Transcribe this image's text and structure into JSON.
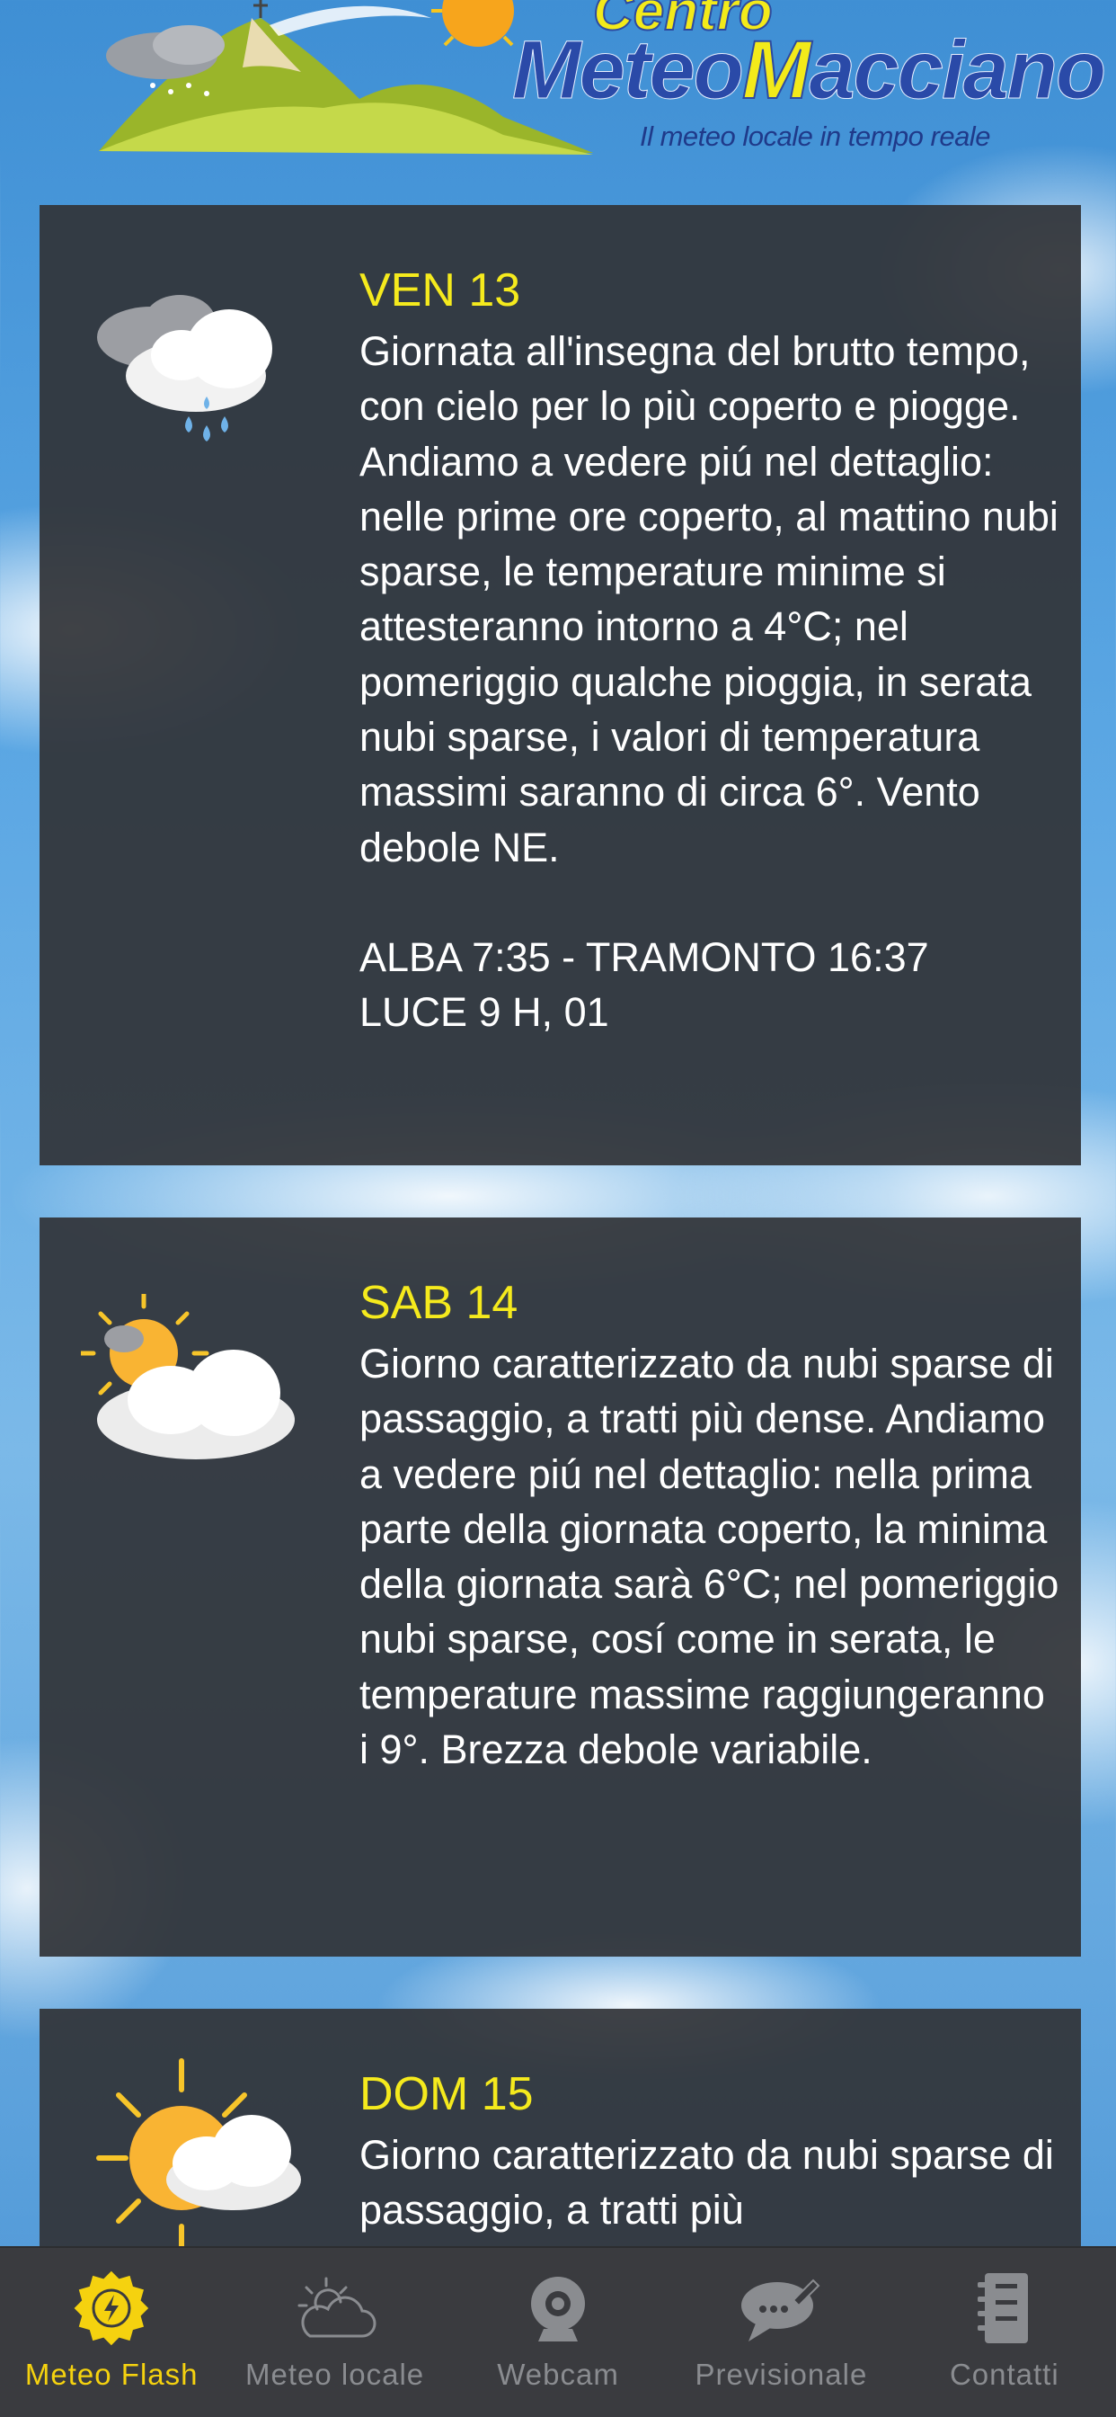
{
  "header": {
    "logo_centro": "Centro",
    "logo_meteo": "Meteo",
    "logo_macciano_initial": "M",
    "logo_macciano_rest": "acciano",
    "logo_subtitle": "Il meteo locale in tempo reale"
  },
  "forecast": [
    {
      "day": "VEN 13",
      "icon": "rain-cloud-icon",
      "description": "Giornata all'insegna del brutto tempo, con cielo per lo più coperto e piogge. Andiamo a vedere piú nel dettaglio: nelle prime ore coperto, al mattino nubi sparse, le temperature minime si attesteranno intorno a 4°C; nel pomeriggio qualche pioggia, in serata nubi sparse, i valori di temperatura massimi saranno di circa 6°. Vento debole NE.",
      "sun_line1": "ALBA 7:35 - TRAMONTO 16:37",
      "sun_line2": "LUCE 9 H, 01"
    },
    {
      "day": "SAB 14",
      "icon": "partly-cloudy-icon",
      "description": "Giorno caratterizzato da nubi sparse di passaggio, a tratti più dense. Andiamo a vedere piú nel dettaglio: nella prima parte della giornata coperto, la minima della giornata sarà 6°C; nel pomeriggio nubi sparse, cosí come in serata, le temperature massime raggiungeranno i 9°. Brezza debole variabile."
    },
    {
      "day": "DOM 15",
      "icon": "sun-cloud-icon",
      "description": "Giorno caratterizzato da nubi sparse di passaggio, a tratti più"
    }
  ],
  "tabs": [
    {
      "label": "Meteo Flash",
      "icon": "lightning-badge-icon",
      "active": true
    },
    {
      "label": "Meteo locale",
      "icon": "sun-cloud-outline-icon",
      "active": false
    },
    {
      "label": "Webcam",
      "icon": "webcam-icon",
      "active": false
    },
    {
      "label": "Previsionale",
      "icon": "chat-bubble-icon",
      "active": false
    },
    {
      "label": "Contatti",
      "icon": "notebook-icon",
      "active": false
    }
  ],
  "colors": {
    "accent_yellow": "#f5ea1d",
    "card_bg": "#323438",
    "tab_active": "#f5d20f",
    "tab_inactive": "#8a8c90"
  }
}
